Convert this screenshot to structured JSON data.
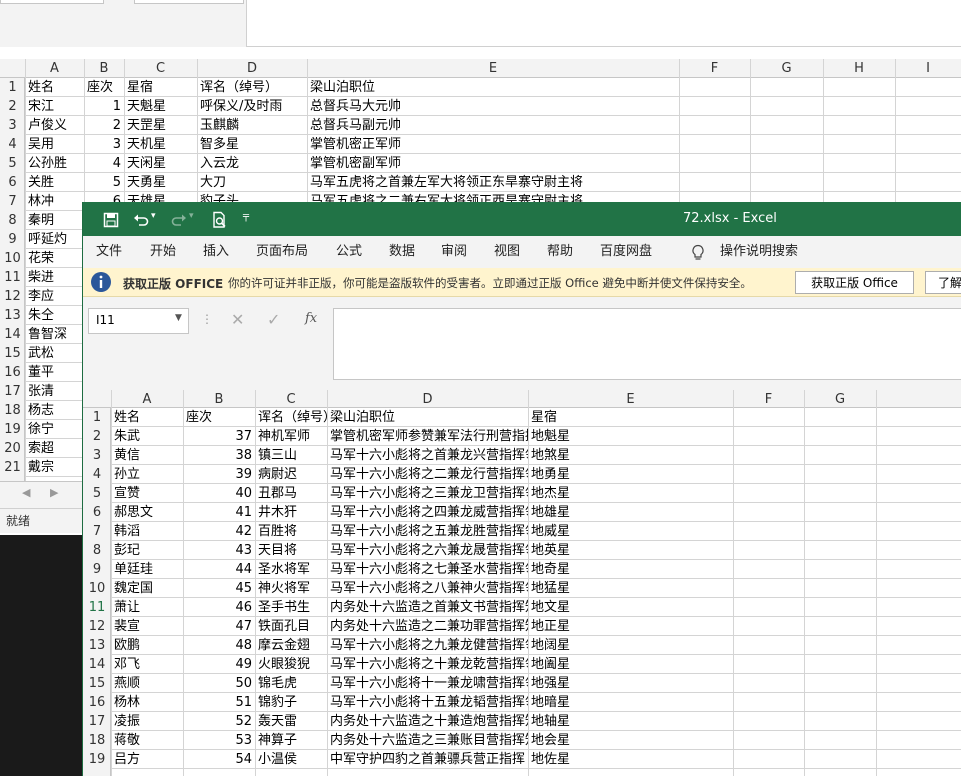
{
  "back": {
    "columns": [
      "A",
      "B",
      "C",
      "D",
      "E",
      "F",
      "G",
      "H",
      "I"
    ],
    "rows": [
      [
        "1",
        "姓名",
        "座次",
        "星宿",
        "诨名（绰号）",
        "梁山泊职位"
      ],
      [
        "2",
        "宋江",
        "1",
        "天魁星",
        "呼保义/及时雨",
        "总督兵马大元帅"
      ],
      [
        "3",
        "卢俊义",
        "2",
        "天罡星",
        "玉麒麟",
        "总督兵马副元帅"
      ],
      [
        "4",
        "吴用",
        "3",
        "天机星",
        "智多星",
        "掌管机密正军师"
      ],
      [
        "5",
        "公孙胜",
        "4",
        "天闲星",
        "入云龙",
        "掌管机密副军师"
      ],
      [
        "6",
        "关胜",
        "5",
        "天勇星",
        "大刀",
        "马军五虎将之首兼左军大将领正东旱寨守尉主将"
      ],
      [
        "7",
        "林冲",
        "6",
        "天雄星",
        "豹子头",
        "马军五虎将之二兼右军大将领正西旱寨守尉主将"
      ]
    ],
    "row_labels": [
      "8",
      "9",
      "10",
      "11",
      "12",
      "13",
      "14",
      "15",
      "16",
      "17",
      "18",
      "19",
      "20",
      "21"
    ],
    "names": [
      "秦明",
      "呼延灼",
      "花荣",
      "柴进",
      "李应",
      "朱仝",
      "鲁智深",
      "武松",
      "董平",
      "张清",
      "杨志",
      "徐宁",
      "索超",
      "戴宗"
    ],
    "status": "就绪"
  },
  "front": {
    "title": "72.xlsx  -  Excel",
    "qat": {
      "save": "save-icon",
      "undo": "undo-icon",
      "redo": "redo-icon",
      "preview": "print-preview-icon",
      "customize": "customize-icon"
    },
    "tabs": [
      "文件",
      "开始",
      "插入",
      "页面布局",
      "公式",
      "数据",
      "审阅",
      "视图",
      "帮助",
      "百度网盘"
    ],
    "tell_me": "操作说明搜索",
    "banner": {
      "title": "获取正版 OFFICE",
      "message": "你的许可证并非正版，你可能是盗版软件的受害者。立即通过正版 Office 避免中断并使文件保持安全。",
      "button1": "获取正版 Office",
      "button2": "了解"
    },
    "name_box": "I11",
    "fx": "fx",
    "columns": [
      "A",
      "B",
      "C",
      "D",
      "E",
      "F",
      "G"
    ],
    "rows": [
      [
        "1",
        "姓名",
        "座次",
        "诨名（绰号）",
        "梁山泊职位",
        "星宿"
      ],
      [
        "2",
        "朱武",
        "37",
        "神机军师",
        "掌管机密军师参赞兼军法行刑营指挥",
        "地魁星"
      ],
      [
        "3",
        "黄信",
        "38",
        "镇三山",
        "马军十六小彪将之首兼龙兴营指挥领寨外讨虏游御副将",
        "地煞星"
      ],
      [
        "4",
        "孙立",
        "39",
        "病尉迟",
        "马军十六小彪将之二兼龙行营指挥领四处旱寨协御副将",
        "地勇星"
      ],
      [
        "5",
        "宣赞",
        "40",
        "丑郡马",
        "马军十六小彪将之三兼龙卫营指挥领正东旱寨守备参将",
        "地杰星"
      ],
      [
        "6",
        "郝思文",
        "41",
        "井木犴",
        "马军十六小彪将之四兼龙威营指挥领正东旱寨守备参将",
        "地雄星"
      ],
      [
        "7",
        "韩滔",
        "42",
        "百胜将",
        "马军十六小彪将之五兼龙胜营指挥领正北旱寨守备参将",
        "地威星"
      ],
      [
        "8",
        "彭玘",
        "43",
        "天目将",
        "马军十六小彪将之六兼龙晟营指挥领正北旱寨守备参将",
        "地英星"
      ],
      [
        "9",
        "单廷珪",
        "44",
        "圣水将军",
        "马军十六小彪将之七兼圣水营指挥领正西旱寨守备参将",
        "地奇星"
      ],
      [
        "10",
        "魏定国",
        "45",
        "神火将军",
        "马军十六小彪将之八兼神火营指挥领正西旱寨守备参将",
        "地猛星"
      ],
      [
        "11",
        "萧让",
        "46",
        "圣手书生",
        "内务处十六监造之首兼文书营指挥知行文走檄调遣事",
        "地文星"
      ],
      [
        "12",
        "裴宣",
        "47",
        "铁面孔目",
        "内务处十六监造之二兼功罪营指挥知定功赏罚政法事",
        "地正星"
      ],
      [
        "13",
        "欧鹏",
        "48",
        "摩云金翅",
        "马军十六小彪将之九兼龙健营指挥领正南旱寨守备参将",
        "地阔星"
      ],
      [
        "14",
        "邓飞",
        "49",
        "火眼狻猊",
        "马军十六小彪将之十兼龙乾营指挥领正南旱寨守备参将",
        "地阖星"
      ],
      [
        "15",
        "燕顺",
        "50",
        "锦毛虎",
        "马军十六小彪将十一兼龙啸营指挥领寨外讨虏游御参将",
        "地强星"
      ],
      [
        "16",
        "杨林",
        "51",
        "锦豹子",
        "马军十六小彪将十五兼龙韬营指挥领四处旱寨协备参将",
        "地暗星"
      ],
      [
        "17",
        "凌振",
        "52",
        "轰天雷",
        "内务处十六监造之十兼造炮营指挥知锻铸大小号炮事",
        "地轴星"
      ],
      [
        "18",
        "蒋敬",
        "53",
        "神算子",
        "内务处十六监造之三兼账目营指挥知考算钱粮支出事",
        "地会星"
      ],
      [
        "19",
        "吕方",
        "54",
        "小温侯",
        "中军守护四豹之首兼骠兵营正指挥",
        "地佐星"
      ]
    ]
  }
}
